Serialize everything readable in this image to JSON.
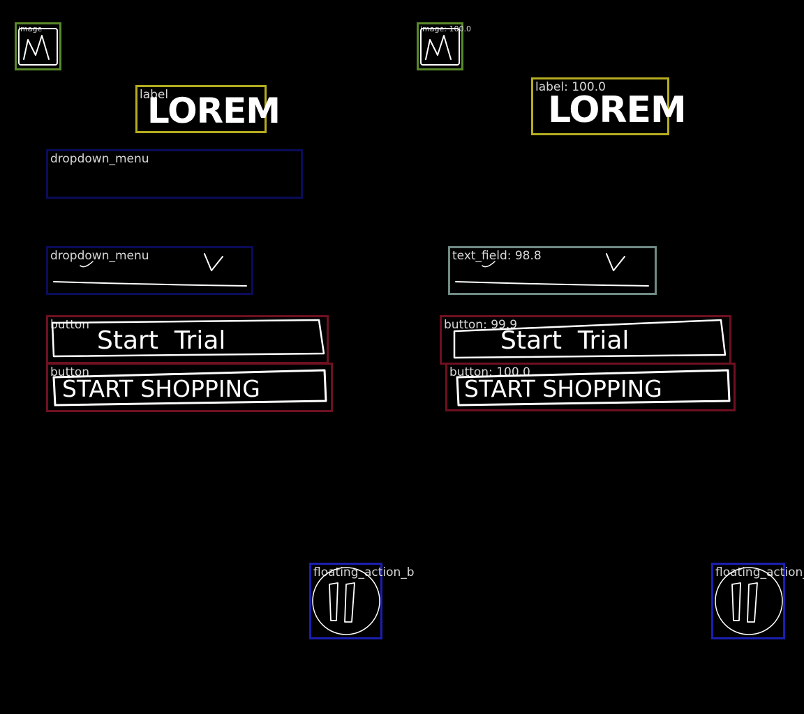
{
  "colors": {
    "image": "#5a8a2a",
    "label": "#b5ad20",
    "dropdown_menu": "#0b0b5a",
    "text_field": "#6f8b84",
    "button": "#6e1020",
    "floating_action_button": "#1a1fb0"
  },
  "left": {
    "image": {
      "tag": "image",
      "icon": "mountain-icon"
    },
    "label": {
      "tag": "label",
      "text": "LOREM"
    },
    "dropdown_1": {
      "tag": "dropdown_menu"
    },
    "dropdown_2": {
      "tag": "dropdown_menu",
      "icon": "chevron-down-icon"
    },
    "button_1": {
      "tag": "button",
      "text": "Start  Trial"
    },
    "button_2": {
      "tag": "button",
      "text": "START SHOPPING"
    },
    "fab": {
      "tag": "floating_action_b",
      "icon": "pause-icon"
    }
  },
  "right": {
    "image": {
      "tag": "image: 100.0",
      "icon": "mountain-icon"
    },
    "label": {
      "tag": "label: 100.0",
      "text": "LOREM"
    },
    "text_field": {
      "tag": "text_field: 98.8",
      "icon": "chevron-down-icon"
    },
    "button_1": {
      "tag": "button: 99.9",
      "text": "Start  Trial"
    },
    "button_2": {
      "tag": "button: 100.0",
      "text": "START SHOPPING"
    },
    "fab": {
      "tag": "floating_action_b",
      "icon": "pause-icon"
    }
  }
}
